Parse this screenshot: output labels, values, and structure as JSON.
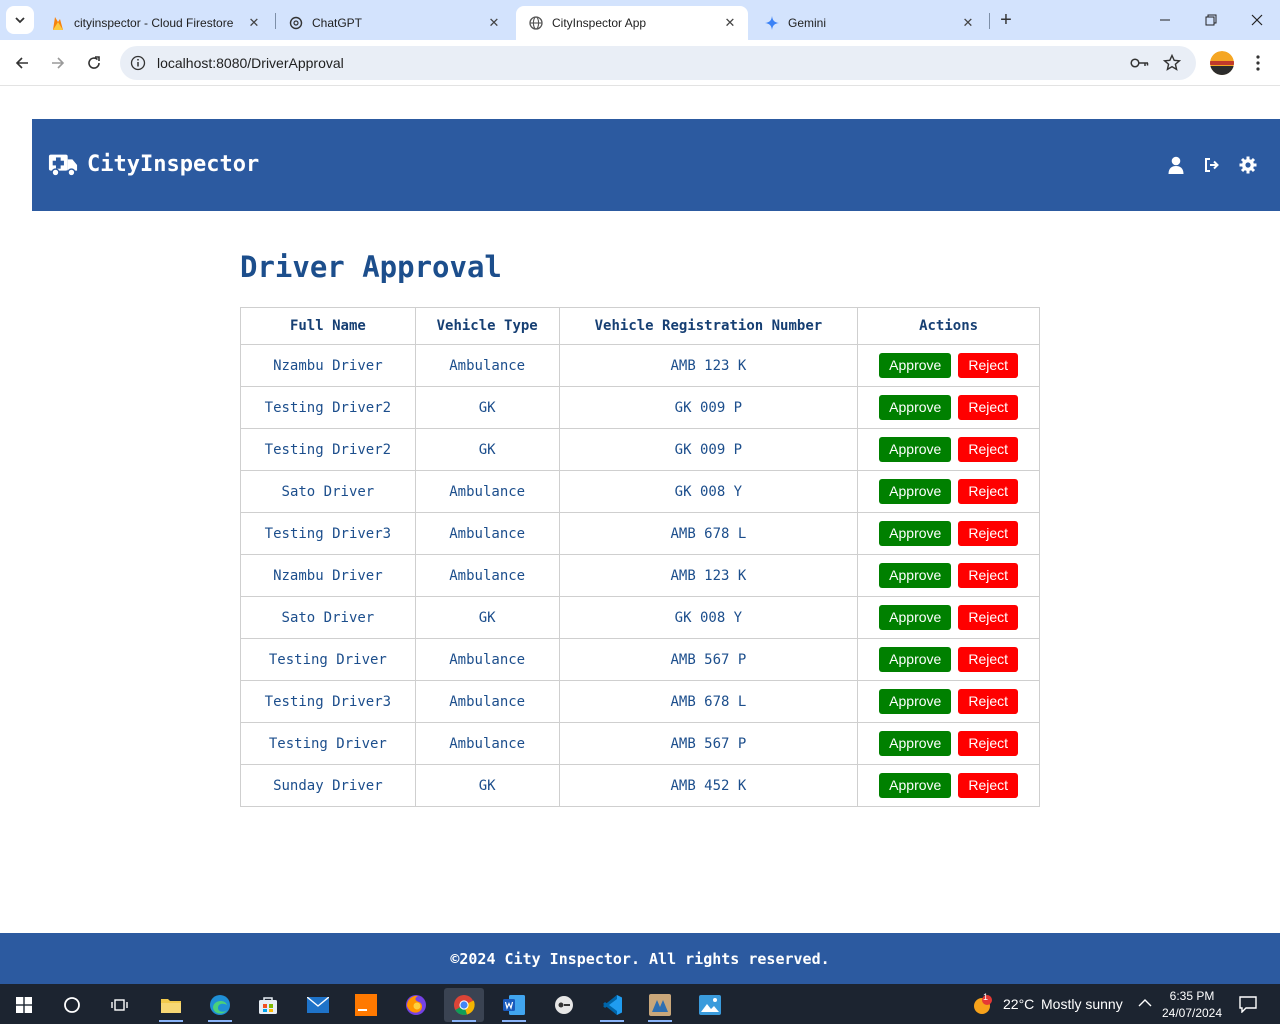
{
  "browser": {
    "tabs": [
      {
        "title": "cityinspector - Cloud Firestore"
      },
      {
        "title": "ChatGPT"
      },
      {
        "title": "CityInspector App"
      },
      {
        "title": "Gemini"
      }
    ],
    "new_tab": "+",
    "address": "localhost:8080/DriverApproval"
  },
  "app": {
    "brand": "CityInspector",
    "page_title": "Driver Approval",
    "table": {
      "columns": [
        "Full Name",
        "Vehicle Type",
        "Vehicle Registration Number",
        "Actions"
      ],
      "approve_label": "Approve",
      "reject_label": "Reject",
      "rows": [
        {
          "name": "Nzambu Driver",
          "type": "Ambulance",
          "reg": "AMB 123 K"
        },
        {
          "name": "Testing Driver2",
          "type": "GK",
          "reg": "GK 009 P"
        },
        {
          "name": "Testing Driver2",
          "type": "GK",
          "reg": "GK 009 P"
        },
        {
          "name": "Sato Driver",
          "type": "Ambulance",
          "reg": "GK 008 Y"
        },
        {
          "name": "Testing Driver3",
          "type": "Ambulance",
          "reg": "AMB 678 L"
        },
        {
          "name": "Nzambu Driver",
          "type": "Ambulance",
          "reg": "AMB 123 K"
        },
        {
          "name": "Sato Driver",
          "type": "GK",
          "reg": "GK 008 Y"
        },
        {
          "name": "Testing Driver",
          "type": "Ambulance",
          "reg": "AMB 567 P"
        },
        {
          "name": "Testing Driver3",
          "type": "Ambulance",
          "reg": "AMB 678 L"
        },
        {
          "name": "Testing Driver",
          "type": "Ambulance",
          "reg": "AMB 567 P"
        },
        {
          "name": "Sunday Driver",
          "type": "GK",
          "reg": "AMB 452 K"
        }
      ]
    },
    "footer": "©2024 City Inspector. All rights reserved."
  },
  "taskbar": {
    "weather_temp": "22°C",
    "weather_text": "Mostly sunny",
    "weather_badge": "1",
    "time": "6:35 PM",
    "date": "24/07/2024"
  },
  "colors": {
    "header": "#2c5aa0",
    "approve": "#008000",
    "reject": "#ff0000",
    "heading": "#1c4e8c"
  }
}
